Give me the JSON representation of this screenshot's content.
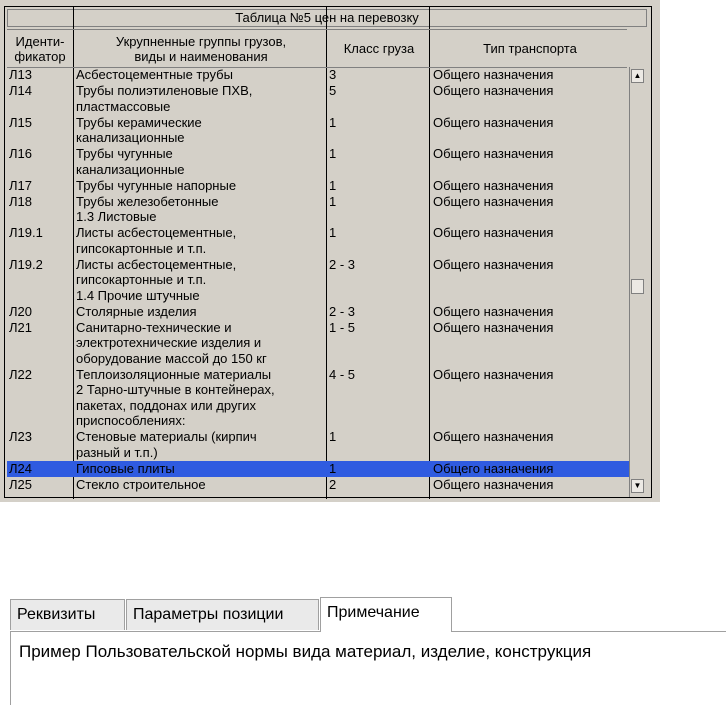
{
  "table": {
    "title": "Таблица №5 цен на перевозку",
    "columns": [
      "Иденти-\nфикатор",
      "Укрупненные группы грузов,\nвиды и наименования",
      "Класс груза",
      "Тип транспорта"
    ],
    "rows": [
      {
        "id": "Л13",
        "name": "Асбестоцементные трубы",
        "class": "3",
        "transport": "Общего назначения",
        "lines": 1
      },
      {
        "id": "Л14",
        "name": "Трубы полиэтиленовые ПХВ,\nпластмассовые",
        "class": "5",
        "transport": "Общего назначения",
        "lines": 2
      },
      {
        "id": "Л15",
        "name": "Трубы керамические\nканализационные",
        "class": "1",
        "transport": "Общего назначения",
        "lines": 2
      },
      {
        "id": "Л16",
        "name": "Трубы чугунные\nканализационные",
        "class": "1",
        "transport": "Общего назначения",
        "lines": 2
      },
      {
        "id": "Л17",
        "name": "Трубы чугунные напорные",
        "class": "1",
        "transport": "Общего назначения",
        "lines": 1
      },
      {
        "id": "Л18",
        "name": "Трубы железобетонные\n   1.3    Листовые",
        "class": "1",
        "transport": "Общего назначения",
        "lines": 2
      },
      {
        "id": "Л19.1",
        "name": "Листы асбестоцементные,\nгипсокартонные и т.п.",
        "class": "1",
        "transport": "Общего назначения",
        "lines": 2
      },
      {
        "id": "Л19.2",
        "name": "Листы асбестоцементные,\nгипсокартонные и т.п.\n   1.4    Прочие штучные",
        "class": "2 - 3",
        "transport": "Общего назначения",
        "lines": 3
      },
      {
        "id": "Л20",
        "name": "Столярные изделия",
        "class": "2 - 3",
        "transport": "Общего назначения",
        "lines": 1
      },
      {
        "id": "Л21",
        "name": "Санитарно-технические и\nэлектротехнические изделия и\nоборудование массой до 150 кг",
        "class": "1 - 5",
        "transport": "Общего назначения",
        "lines": 3
      },
      {
        "id": "Л22",
        "name": "Теплоизоляционные материалы\n2 Тарно-штучные в контейнерах,\nпакетах, поддонах или других\nприспособлениях:",
        "class": "4 - 5",
        "transport": "Общего назначения",
        "lines": 4
      },
      {
        "id": "Л23",
        "name": "Стеновые материалы (кирпич\nразный и т.п.)",
        "class": "1",
        "transport": "Общего назначения",
        "lines": 2
      },
      {
        "id": "Л24",
        "name": "Гипсовые плиты",
        "class": "1",
        "transport": "Общего назначения",
        "lines": 1,
        "selected": true
      },
      {
        "id": "Л25",
        "name": "Стекло строительное",
        "class": "2",
        "transport": "Общего назначения",
        "lines": 1
      }
    ],
    "scrollbar": {
      "up_glyph": "▲",
      "down_glyph": "▼"
    }
  },
  "tabs": {
    "items": [
      "Реквизиты",
      "Параметры позиции",
      "Примечание"
    ],
    "active_index": 2,
    "note": "Пример Пользовательской нормы вида материал, изделие, конструкция"
  }
}
